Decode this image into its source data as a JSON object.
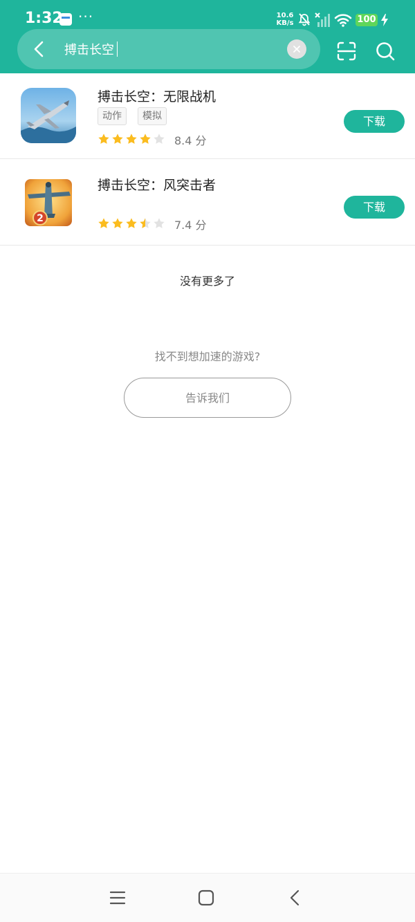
{
  "status_bar": {
    "time": "1:32",
    "more": "···",
    "net_speed_value": "10.6",
    "net_speed_unit": "KB/s",
    "battery": "100",
    "icons": [
      "notification-app-icon",
      "mute-icon",
      "signal-icon",
      "wifi-icon",
      "battery-icon",
      "charging-icon"
    ]
  },
  "search": {
    "query": "搏击长空",
    "icons": [
      "back-icon",
      "clear-icon",
      "scan-icon",
      "search-icon"
    ]
  },
  "results": [
    {
      "name": "搏击长空：无限战机",
      "tags": [
        "动作",
        "模拟"
      ],
      "rating": 8.4,
      "rating_text": "8.4 分",
      "download_label": "下载"
    },
    {
      "name": "搏击长空：风突击者",
      "tags": [],
      "rating": 7.4,
      "rating_text": "7.4 分",
      "download_label": "下载"
    }
  ],
  "footer": {
    "no_more": "没有更多了",
    "cant_find": "找不到想加速的游戏?",
    "tell_us": "告诉我们"
  },
  "colors": {
    "accent": "#1fb59c",
    "star": "#fbbc1f",
    "star_empty": "#e2e2e2"
  }
}
